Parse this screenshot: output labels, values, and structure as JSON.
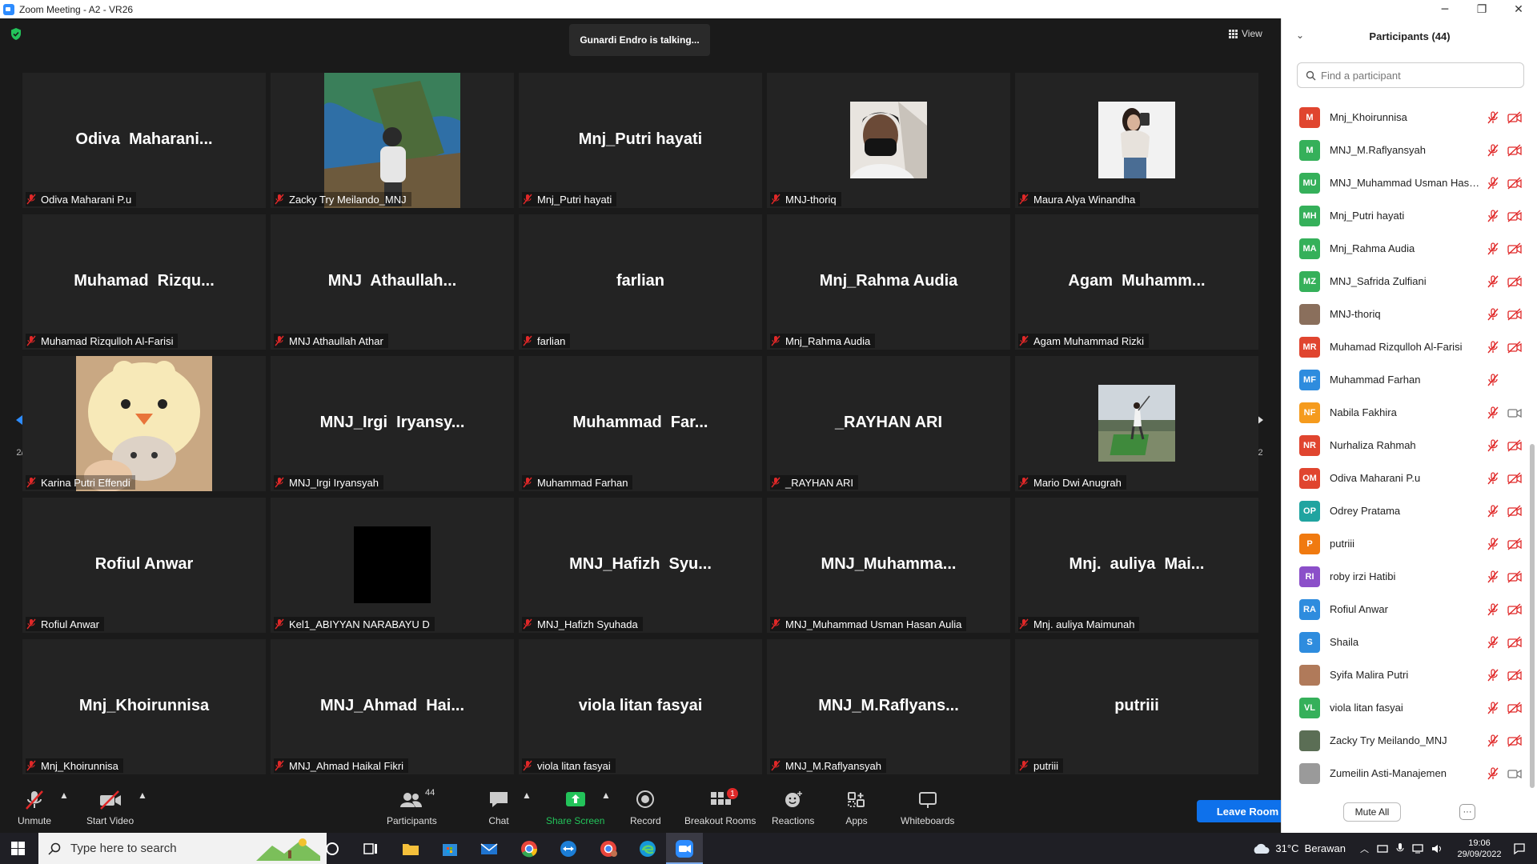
{
  "window": {
    "title": "Zoom Meeting - A2 - VR26",
    "minimize": "─",
    "maximize": "❐",
    "close": "✕"
  },
  "meeting": {
    "talking": "Gunardi Endro is talking...",
    "view_label": "View",
    "page_indicator_left": "2/2",
    "page_indicator_right": "2/2",
    "tiles": [
      {
        "big": "Odiva  Maharani...",
        "label": "Odiva Maharani P.u"
      },
      {
        "big": "",
        "label": "Zacky Try Meilando_MNJ",
        "photo": "cliff-photo"
      },
      {
        "big": "Mnj_Putri hayati",
        "label": "Mnj_Putri hayati"
      },
      {
        "big": "",
        "label": "MNJ-thoriq",
        "photo": "selfie-photo"
      },
      {
        "big": "",
        "label": "Maura Alya Winandha",
        "photo": "mirror-photo"
      },
      {
        "big": "Muhamad  Rizqu...",
        "label": "Muhamad Rizqulloh Al-Farisi"
      },
      {
        "big": "MNJ  Athaullah...",
        "label": "MNJ Athaullah Athar"
      },
      {
        "big": "farlian",
        "label": "farlian"
      },
      {
        "big": "Mnj_Rahma Audia",
        "label": "Mnj_Rahma Audia"
      },
      {
        "big": "Agam  Muhamm...",
        "label": "Agam Muhammad Rizki"
      },
      {
        "big": "",
        "label": "Karina Putri Effendi",
        "photo": "kitten-photo"
      },
      {
        "big": "MNJ_Irgi  Iryansy...",
        "label": "MNJ_Irgi Iryansyah"
      },
      {
        "big": "Muhammad  Far...",
        "label": "Muhammad Farhan"
      },
      {
        "big": "_RAYHAN ARI",
        "label": "_RAYHAN ARI"
      },
      {
        "big": "",
        "label": "Mario Dwi Anugrah",
        "photo": "golf-photo"
      },
      {
        "big": "Rofiul Anwar",
        "label": "Rofiul Anwar"
      },
      {
        "big": "",
        "label": "Kel1_ABIYYAN NARABAYU D",
        "photo": "black-photo"
      },
      {
        "big": "MNJ_Hafizh  Syu...",
        "label": "MNJ_Hafizh Syuhada"
      },
      {
        "big": "MNJ_Muhamma...",
        "label": "MNJ_Muhammad Usman Hasan Aulia"
      },
      {
        "big": "Mnj.  auliya  Mai...",
        "label": "Mnj. auliya Maimunah"
      },
      {
        "big": "Mnj_Khoirunnisa",
        "label": "Mnj_Khoirunnisa"
      },
      {
        "big": "MNJ_Ahmad  Hai...",
        "label": "MNJ_Ahmad Haikal Fikri"
      },
      {
        "big": "viola litan fasyai",
        "label": "viola litan fasyai"
      },
      {
        "big": "MNJ_M.Raflyans...",
        "label": "MNJ_M.Raflyansyah"
      },
      {
        "big": "putriii",
        "label": "putriii"
      }
    ]
  },
  "toolbar": {
    "unmute": "Unmute",
    "start_video": "Start Video",
    "participants": "Participants",
    "participants_count": "44",
    "chat": "Chat",
    "share_screen": "Share Screen",
    "record": "Record",
    "breakout_rooms": "Breakout Rooms",
    "breakout_badge": "1",
    "reactions": "Reactions",
    "apps": "Apps",
    "whiteboards": "Whiteboards",
    "leave": "Leave Room"
  },
  "panel": {
    "title": "Participants (44)",
    "search_placeholder": "Find a participant",
    "mute_all": "Mute All",
    "more": "···",
    "participants": [
      {
        "initials": "M",
        "name": "Mnj_Khoirunnisa",
        "color": "#e0452f",
        "video": "off"
      },
      {
        "initials": "M",
        "name": "MNJ_M.Raflyansyah",
        "color": "#35b05a",
        "video": "off"
      },
      {
        "initials": "MU",
        "name": "MNJ_Muhammad Usman Hasa...",
        "color": "#35b05a",
        "video": "off"
      },
      {
        "initials": "MH",
        "name": "Mnj_Putri hayati",
        "color": "#35b05a",
        "video": "off"
      },
      {
        "initials": "MA",
        "name": "Mnj_Rahma Audia",
        "color": "#35b05a",
        "video": "off"
      },
      {
        "initials": "MZ",
        "name": "MNJ_Safrida Zulfiani",
        "color": "#35b05a",
        "video": "off"
      },
      {
        "initials": "",
        "name": "MNJ-thoriq",
        "color": "#8a6f5c",
        "video": "off"
      },
      {
        "initials": "MR",
        "name": "Muhamad Rizqulloh Al-Farisi",
        "color": "#e0452f",
        "video": "off"
      },
      {
        "initials": "MF",
        "name": "Muhammad Farhan",
        "color": "#2e8cde",
        "video": "none"
      },
      {
        "initials": "NF",
        "name": "Nabila Fakhira",
        "color": "#f59b1e",
        "video": "on"
      },
      {
        "initials": "NR",
        "name": "Nurhaliza Rahmah",
        "color": "#e0452f",
        "video": "off"
      },
      {
        "initials": "OM",
        "name": "Odiva Maharani P.u",
        "color": "#e0452f",
        "video": "off"
      },
      {
        "initials": "OP",
        "name": "Odrey Pratama",
        "color": "#20a4a0",
        "video": "off"
      },
      {
        "initials": "P",
        "name": "putriii",
        "color": "#f07a10",
        "video": "off"
      },
      {
        "initials": "RI",
        "name": "roby irzi Hatibi",
        "color": "#8b4fc9",
        "video": "off"
      },
      {
        "initials": "RA",
        "name": "Rofiul Anwar",
        "color": "#2e8cde",
        "video": "off"
      },
      {
        "initials": "S",
        "name": "Shaila",
        "color": "#2e8cde",
        "video": "off"
      },
      {
        "initials": "",
        "name": "Syifa Malira Putri",
        "color": "#b07a5a",
        "video": "off"
      },
      {
        "initials": "VL",
        "name": "viola litan fasyai",
        "color": "#35b05a",
        "video": "off"
      },
      {
        "initials": "",
        "name": "Zacky Try Meilando_MNJ",
        "color": "#5b6e55",
        "video": "off"
      },
      {
        "initials": "",
        "name": "Zumeilin Asti-Manajemen",
        "color": "#9a9a9a",
        "video": "on"
      }
    ]
  },
  "taskbar": {
    "search_placeholder": "Type here to search",
    "weather": "31°C  Berawan",
    "time": "19:06",
    "date": "29/09/2022"
  }
}
